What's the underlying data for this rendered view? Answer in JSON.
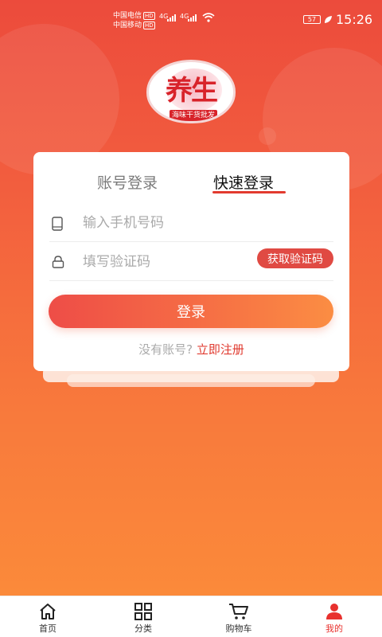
{
  "status_bar": {
    "carrier1": "中国电信",
    "carrier2": "中国移动",
    "hd": "HD",
    "net": "4G",
    "battery": "57",
    "time": "15:26"
  },
  "logo": {
    "title": "养生",
    "subtitle": "海味干货批发"
  },
  "tabs": [
    {
      "label": "账号登录",
      "active": false
    },
    {
      "label": "快速登录",
      "active": true
    }
  ],
  "form": {
    "phone_placeholder": "输入手机号码",
    "code_placeholder": "填写验证码",
    "get_code_label": "获取验证码",
    "login_label": "登录",
    "register_prompt": "没有账号?",
    "register_link": "立即注册"
  },
  "nav": [
    {
      "label": "首页",
      "icon": "home-icon"
    },
    {
      "label": "分类",
      "icon": "grid-icon"
    },
    {
      "label": "购物车",
      "icon": "cart-icon"
    },
    {
      "label": "我的",
      "icon": "user-icon",
      "active": true
    }
  ],
  "colors": {
    "accent": "#e8312e",
    "gradient_top": "#ec4b3c",
    "gradient_bottom": "#fb8a3a"
  }
}
